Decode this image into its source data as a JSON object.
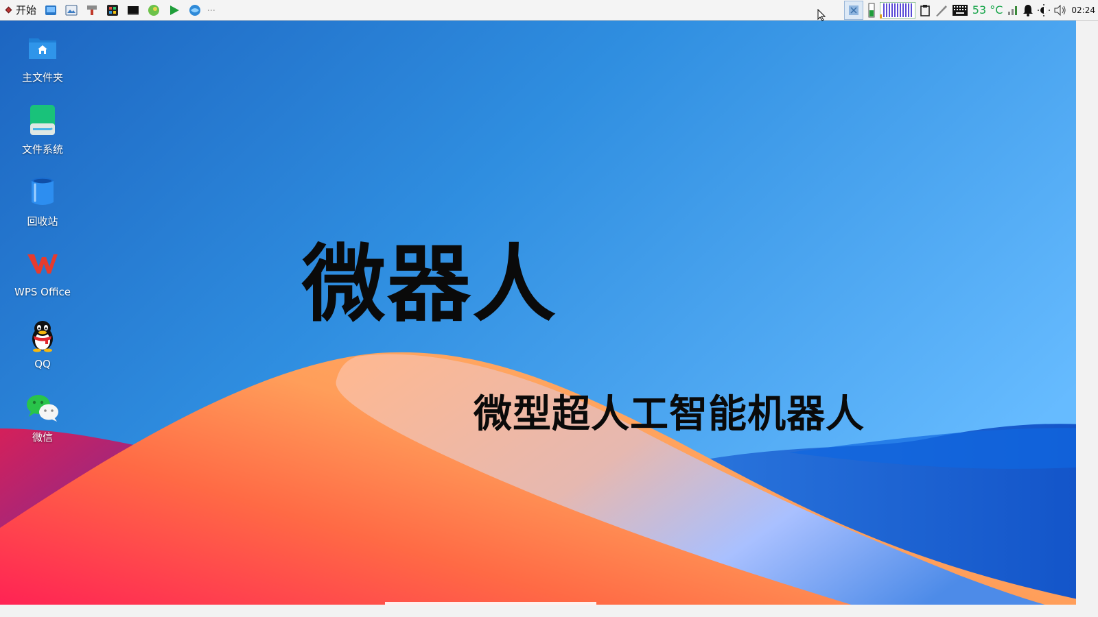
{
  "taskbar": {
    "start_label": "开始",
    "launchers": [
      "file-manager-icon",
      "image-viewer-icon",
      "paint-brush-icon",
      "color-picker-icon",
      "terminal-icon",
      "globe-green-icon",
      "play-icon",
      "browser-icon"
    ],
    "temperature": "53 °C",
    "clock": "02:24"
  },
  "desktop": {
    "icons": [
      {
        "label": "主文件夹",
        "icon": "home-folder-icon"
      },
      {
        "label": "文件系统",
        "icon": "drive-icon"
      },
      {
        "label": "回收站",
        "icon": "trash-icon"
      },
      {
        "label": "WPS Office",
        "icon": "wps-icon"
      },
      {
        "label": "QQ",
        "icon": "qq-icon"
      },
      {
        "label": "微信",
        "icon": "wechat-icon"
      }
    ]
  },
  "wallpaper": {
    "title": "微器人",
    "subtitle": "微型超人工智能机器人"
  }
}
